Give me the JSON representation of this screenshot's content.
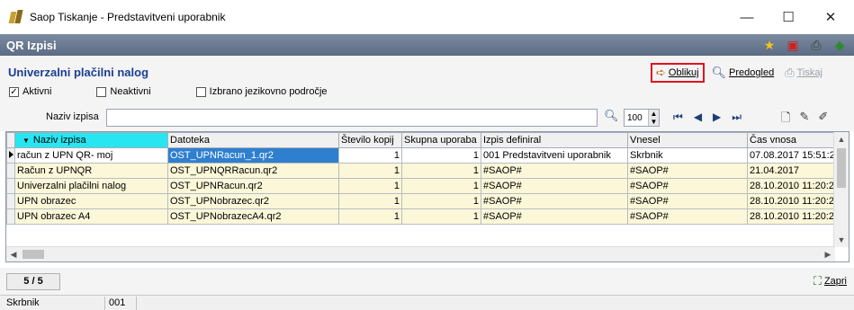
{
  "window": {
    "title": "Saop Tiskanje - Predstavitveni uporabnik",
    "min_glyph": "—",
    "max_glyph": "☐",
    "close_glyph": "✕"
  },
  "section_bar": {
    "label": "QR Izpisi",
    "icons": [
      "star-icon",
      "pdf-icon",
      "printer-icon",
      "book-icon"
    ]
  },
  "header": {
    "title": "Univerzalni plačilni nalog",
    "checks": [
      {
        "label": "Aktivni",
        "checked": true
      },
      {
        "label": "Neaktivni",
        "checked": false
      },
      {
        "label": "Izbrano jezikovno področje",
        "checked": false
      }
    ],
    "buttons": {
      "oblikuj": "Oblikuj",
      "predogled": "Predogled",
      "tiskaj": "Tiskaj"
    }
  },
  "filter": {
    "label": "Naziv izpisa",
    "value": "",
    "zoom": "100"
  },
  "grid": {
    "columns": [
      "Naziv izpisa",
      "Datoteka",
      "Število kopij",
      "Skupna uporaba",
      "Izpis definiral",
      "Vnesel",
      "Čas vnosa"
    ],
    "rows": [
      {
        "naziv": "račun z UPN QR- moj",
        "datoteka": "OST_UPNRacun_1.qr2",
        "kopije": "1",
        "skupna": "1",
        "definiral": "001 Predstavitveni uporabnik",
        "vnesel": "Skrbnik",
        "cas": "07.08.2017 15:51:2"
      },
      {
        "naziv": "Račun z UPNQR",
        "datoteka": "OST_UPNQRRacun.qr2",
        "kopije": "1",
        "skupna": "1",
        "definiral": "#SAOP#",
        "vnesel": "#SAOP#",
        "cas": "21.04.2017"
      },
      {
        "naziv": "Univerzalni plačilni nalog",
        "datoteka": "OST_UPNRacun.qr2",
        "kopije": "1",
        "skupna": "1",
        "definiral": "#SAOP#",
        "vnesel": "#SAOP#",
        "cas": "28.10.2010 11:20:2"
      },
      {
        "naziv": "UPN obrazec",
        "datoteka": "OST_UPNobrazec.qr2",
        "kopije": "1",
        "skupna": "1",
        "definiral": "#SAOP#",
        "vnesel": "#SAOP#",
        "cas": "28.10.2010 11:20:2"
      },
      {
        "naziv": "UPN obrazec A4",
        "datoteka": "OST_UPNobrazecA4.qr2",
        "kopije": "1",
        "skupna": "1",
        "definiral": "#SAOP#",
        "vnesel": "#SAOP#",
        "cas": "28.10.2010 11:20:2"
      }
    ]
  },
  "bottom": {
    "counter": "5 / 5",
    "close_label": "Zapri"
  },
  "status": {
    "user": "Skrbnik",
    "code": "001"
  },
  "colors": {
    "section_title": "#1a3f91",
    "sorted_header": "#27e6f2",
    "row_bg": "#fbf7d8",
    "selected_cell": "#2f7fcf",
    "highlight_border": "#e0131d"
  }
}
